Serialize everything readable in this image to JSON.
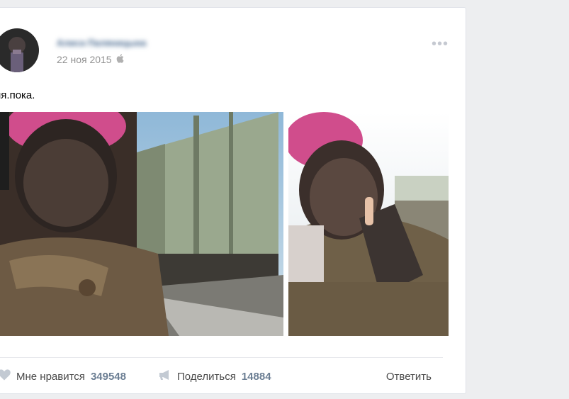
{
  "post": {
    "author": "Алиса Паляницына",
    "date": "22 ноя 2015",
    "platform_icon": "apple-icon",
    "more_icon": "more-dots-icon",
    "text": "ня.пока.",
    "photos": [
      {
        "alt": "selfie-by-train"
      },
      {
        "alt": "selfie-peace-sign"
      }
    ]
  },
  "actions": {
    "like_label": "Мне нравится",
    "like_count": "349548",
    "share_label": "Поделиться",
    "share_count": "14884",
    "reply_label": "Ответить"
  },
  "colors": {
    "background": "#edeef0",
    "author_link": "#42648b",
    "count": "#6b7e93",
    "meta": "#939393"
  }
}
